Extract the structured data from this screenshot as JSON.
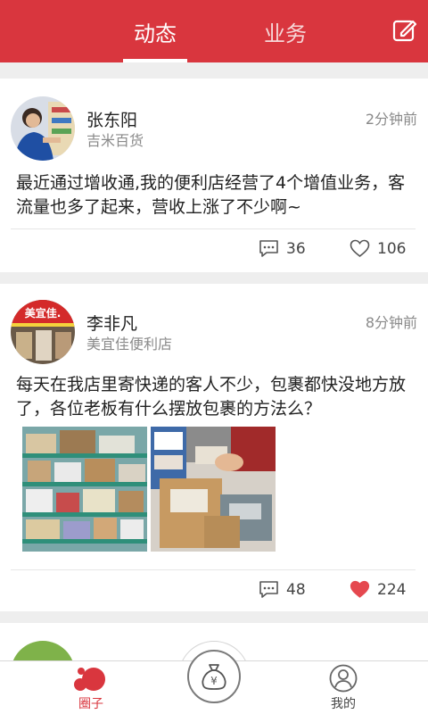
{
  "header": {
    "tab_active": "动态",
    "tab_inactive": "业务",
    "edit_icon": "edit-icon",
    "brand_color": "#d9363e"
  },
  "posts": [
    {
      "name": "张东阳",
      "store": "吉米百货",
      "time": "2分钟前",
      "content": "最近通过增收通,我的便利店经营了4个增值业务，客流量也多了起来，营收上涨了不少啊~",
      "comments": "36",
      "likes": "106",
      "liked": false
    },
    {
      "name": "李非凡",
      "store": "美宜佳便利店",
      "time": "8分钟前",
      "content": "每天在我店里寄快递的客人不少，包裹都快没地方放了，各位老板有什么摆放包裹的方法么？",
      "avatar_sign": "美宜佳.",
      "comments": "48",
      "likes": "224",
      "liked": true
    }
  ],
  "bottom_nav": {
    "circle_label": "圈子",
    "center_icon": "money-bag-icon",
    "mine_label": "我的",
    "active_color": "#d9363e"
  }
}
